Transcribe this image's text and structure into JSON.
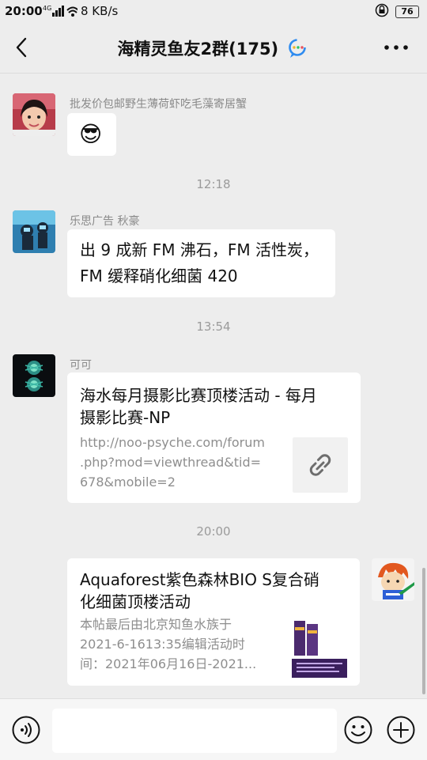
{
  "status_bar": {
    "time": "20:00",
    "signal": "4G",
    "speed": "8 KB/s",
    "battery": "76"
  },
  "header": {
    "title": "海精灵鱼友2群(175)"
  },
  "messages": [
    {
      "type": "emoji",
      "sender": "批发价包邮野生薄荷虾吃毛藻寄居蟹",
      "content": "😎"
    },
    {
      "type": "time",
      "text": "12:18"
    },
    {
      "type": "text",
      "sender": "乐思广告 秋豪",
      "lines": [
        "出 9 成新 FM 沸石，FM 活性炭，",
        "FM 缓释硝化细菌 420"
      ]
    },
    {
      "type": "time",
      "text": "13:54"
    },
    {
      "type": "link",
      "sender": "可可",
      "title_lines": [
        "海水每月摄影比赛顶楼活动 - 每月",
        "摄影比赛-NP"
      ],
      "desc_lines": [
        "http://noo-psyche.com/forum",
        ".php?mod=viewthread&tid=",
        "678&mobile=2"
      ],
      "thumb_icon": "link-icon"
    },
    {
      "type": "time",
      "text": "20:00"
    },
    {
      "type": "link-self",
      "title_lines": [
        "Aquaforest紫色森林BIO S复合硝",
        "化细菌顶楼活动"
      ],
      "desc_lines": [
        "本帖最后由北京知鱼水族于",
        "2021-6-1613:35编辑活动时",
        "间：2021年06月16日-2021..."
      ]
    }
  ],
  "colors": {
    "background": "#ededed",
    "bubble": "#ffffff",
    "accent_blue": "#2f8cf0",
    "accent_green": "#29c26a"
  }
}
